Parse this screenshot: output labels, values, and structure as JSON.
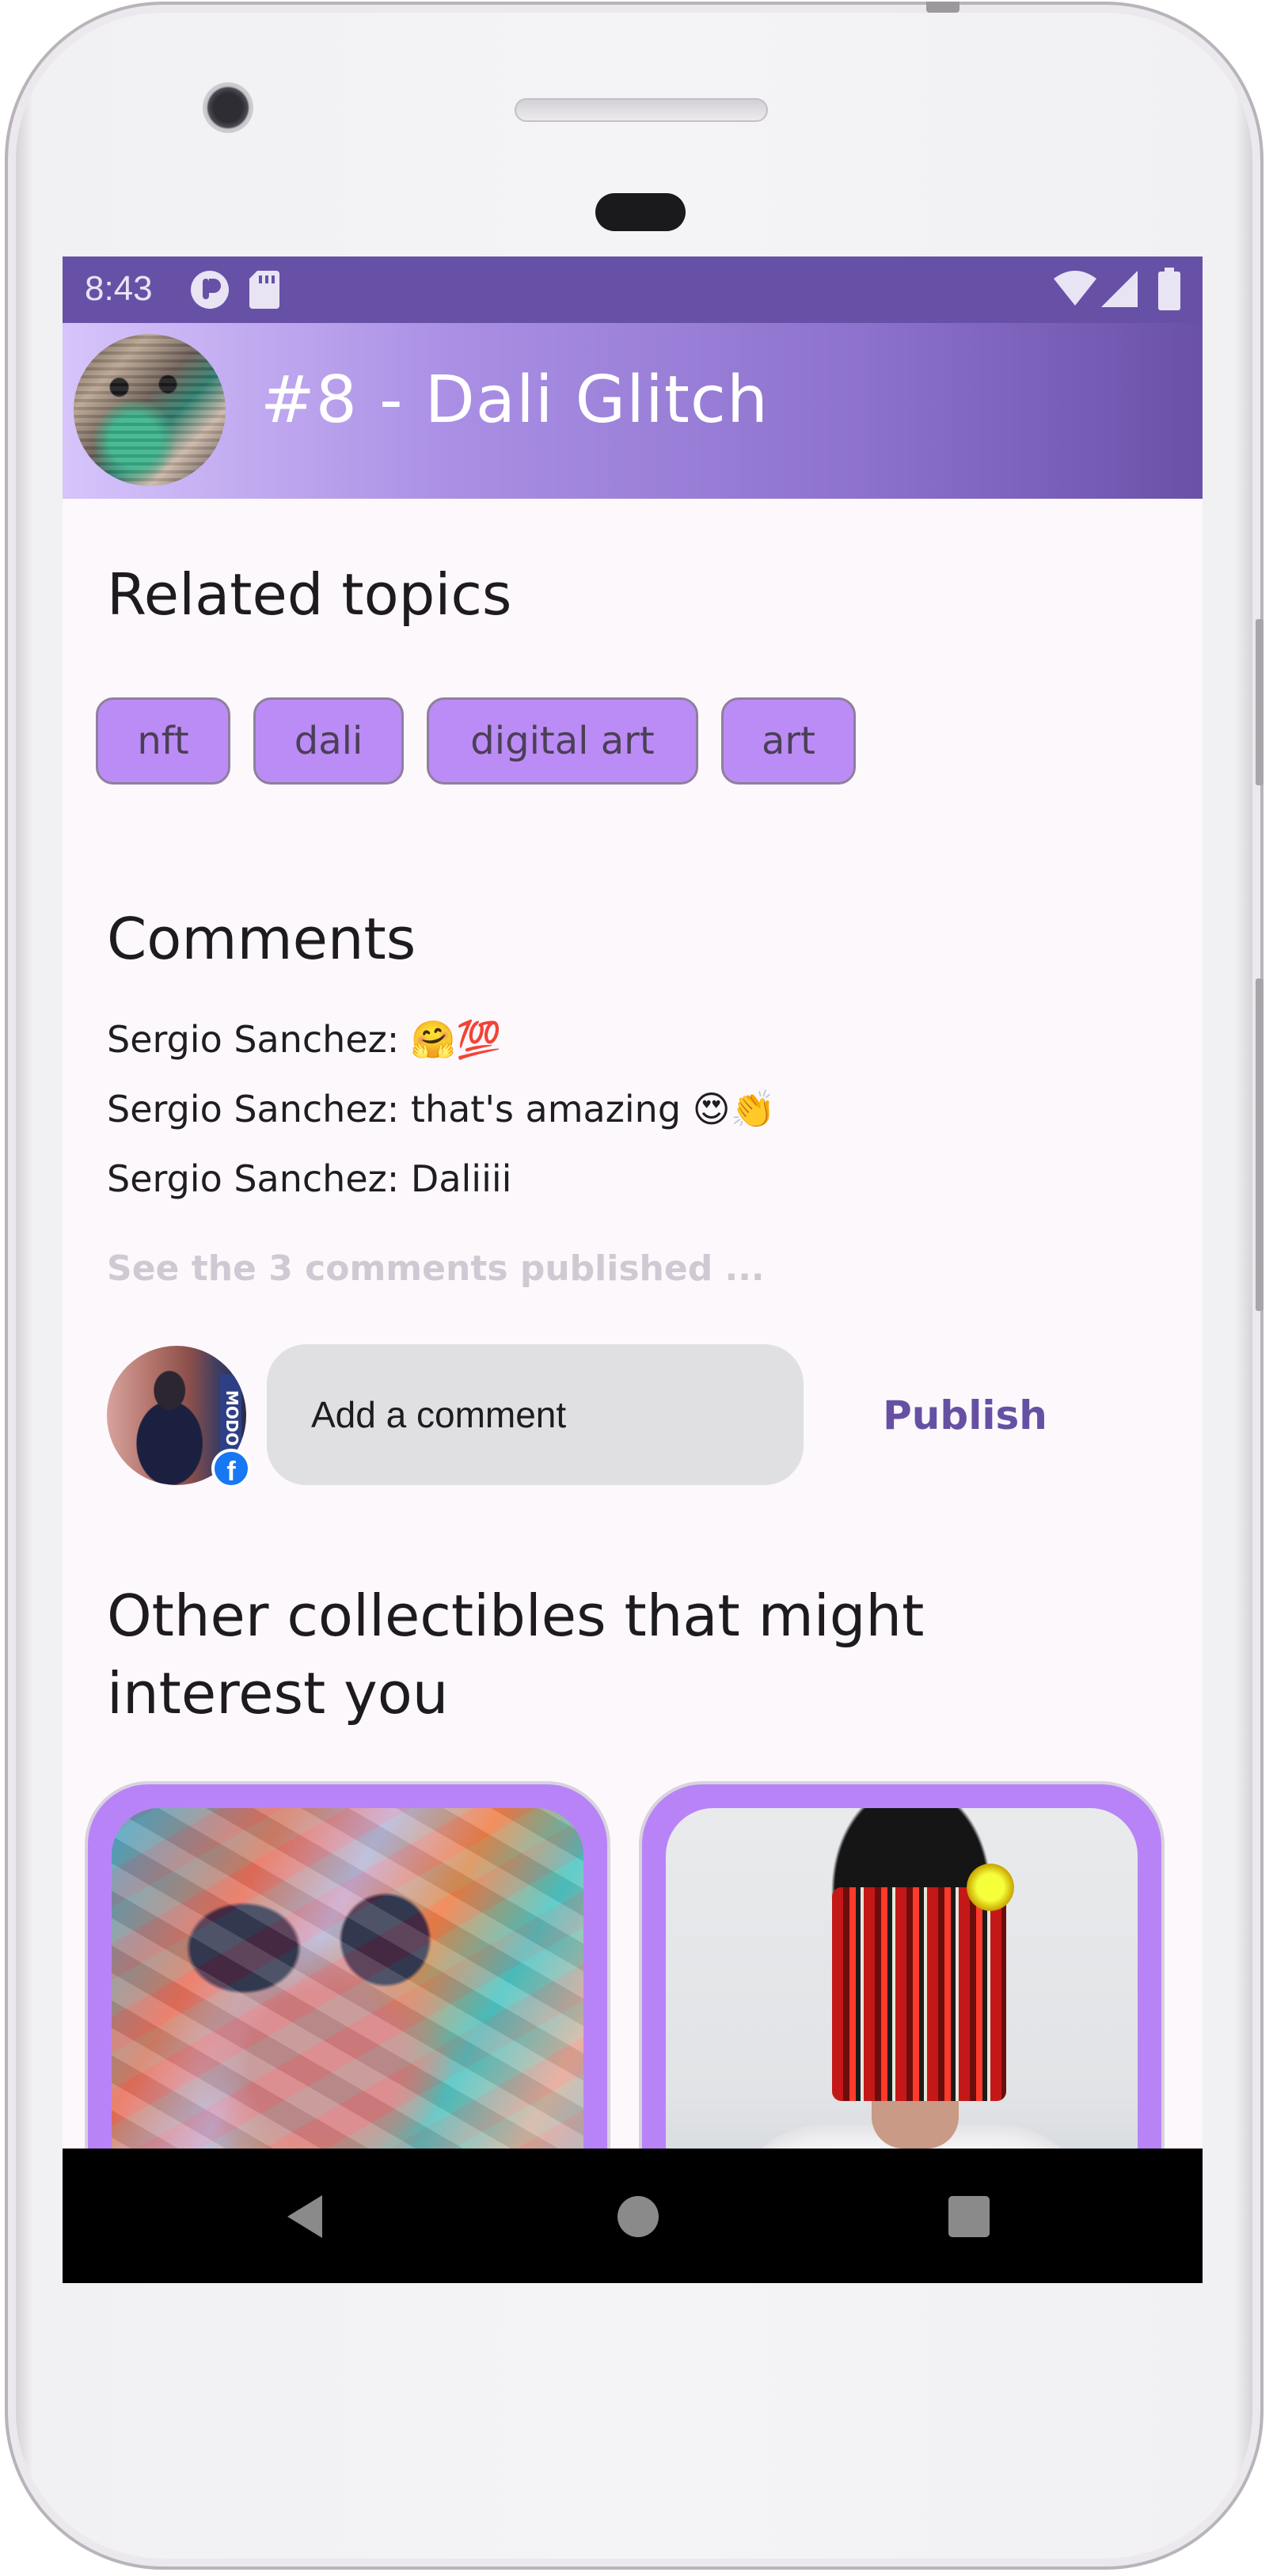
{
  "status_bar": {
    "time": "8:43"
  },
  "app_bar": {
    "title": "#8 - Dali Glitch"
  },
  "related": {
    "heading": "Related topics",
    "chips": [
      "nft",
      "dali",
      "digital art",
      "art"
    ]
  },
  "comments": {
    "heading": "Comments",
    "items": [
      {
        "author": "Sergio Sanchez",
        "text": "🤗💯",
        "line": "Sergio Sanchez: 🤗💯"
      },
      {
        "author": "Sergio Sanchez",
        "text": "that's amazing 😍👏",
        "line": "Sergio Sanchez: that's amazing 😍👏"
      },
      {
        "author": "Sergio Sanchez",
        "text": "Daliiii",
        "line": "Sergio Sanchez: Daliiii"
      }
    ],
    "see_all": "See the 3 comments published ...",
    "input_placeholder": "Add a comment",
    "publish_label": "Publish",
    "avatar_badge": "MODO"
  },
  "other": {
    "heading_line1": "Other collectibles that might",
    "heading_line2": "interest you"
  },
  "colors": {
    "status_bar": "#6751a6",
    "chip_bg": "#bb8cf5",
    "accent": "#6650a4",
    "card_bg": "#b983f8",
    "screen_bg": "#fcf8fc"
  },
  "icons": {
    "status": [
      "notification-icon",
      "sd-card-icon",
      "wifi-icon",
      "signal-icon",
      "battery-icon"
    ],
    "nav": [
      "back-icon",
      "home-icon",
      "recents-icon"
    ]
  }
}
